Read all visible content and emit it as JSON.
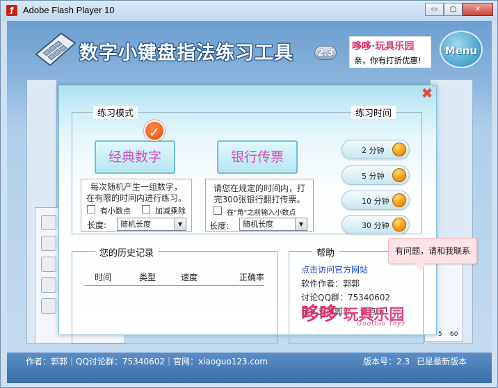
{
  "window": {
    "title": "Adobe Flash Player 10",
    "icon": "flash-icon",
    "controls": {
      "minimize": "▭",
      "restore": "▢",
      "close": "✕"
    }
  },
  "header": {
    "app_title": "数字小键盘指法练习工具",
    "version_badge": "2.3",
    "promo_logo": {
      "part_a": "哆哆",
      "part_b": "·",
      "part_c": "玩具乐园"
    },
    "promo_text": "亲，你有打折优惠!",
    "menu_label": "Menu"
  },
  "dialog": {
    "close_glyph": "✖",
    "practice_mode": {
      "title": "练习模式",
      "modes": [
        {
          "label": "经典数字",
          "selected": true,
          "description": [
            "每次随机产生一组数字，",
            "在有限的时间内进行练习。"
          ],
          "options": [
            "有小数点",
            "加减乘除"
          ],
          "length_label": "长度:",
          "length_value": "随机长度"
        },
        {
          "label": "银行传票",
          "selected": false,
          "description": [
            "请您在规定的时间内，打",
            "完300张银行翻打传票。"
          ],
          "options": [
            "在\"角\"之前输入小数点"
          ],
          "length_label": "长度:",
          "length_value": "随机长度"
        }
      ]
    },
    "practice_time": {
      "title": "练习时间",
      "options": [
        "2 分钟",
        "5 分钟",
        "10 分钟",
        "30 分钟"
      ]
    },
    "history": {
      "title": "您的历史记录",
      "columns": [
        "时间",
        "类型",
        "速度",
        "正确率"
      ]
    },
    "help": {
      "title": "帮助",
      "website_link": "点击访问官方网站",
      "author": "软件作者：郭郭",
      "qq_group": "讨论QQ群：75340602",
      "support": "亲，支持郭郭，请点击!",
      "tooltip": "有问题，请和我联系",
      "logo": {
        "part_a": "哆哆",
        "part_b": "·",
        "part_c": "玩具乐园",
        "sub": "DuoDuo    Toys"
      }
    }
  },
  "footer": {
    "credits": "作者：郭郭｜QQ讨论群：75340602｜官网：xiaoguo123.com",
    "version": "版本号：2.3",
    "status": "已是最新版本",
    "axis_labels": [
      "5",
      "60"
    ]
  },
  "colors": {
    "mode_text": "#d64ebd",
    "link": "#1a4dcc",
    "accent_orange": "#ff9a12",
    "close_red": "#e24c3a"
  }
}
